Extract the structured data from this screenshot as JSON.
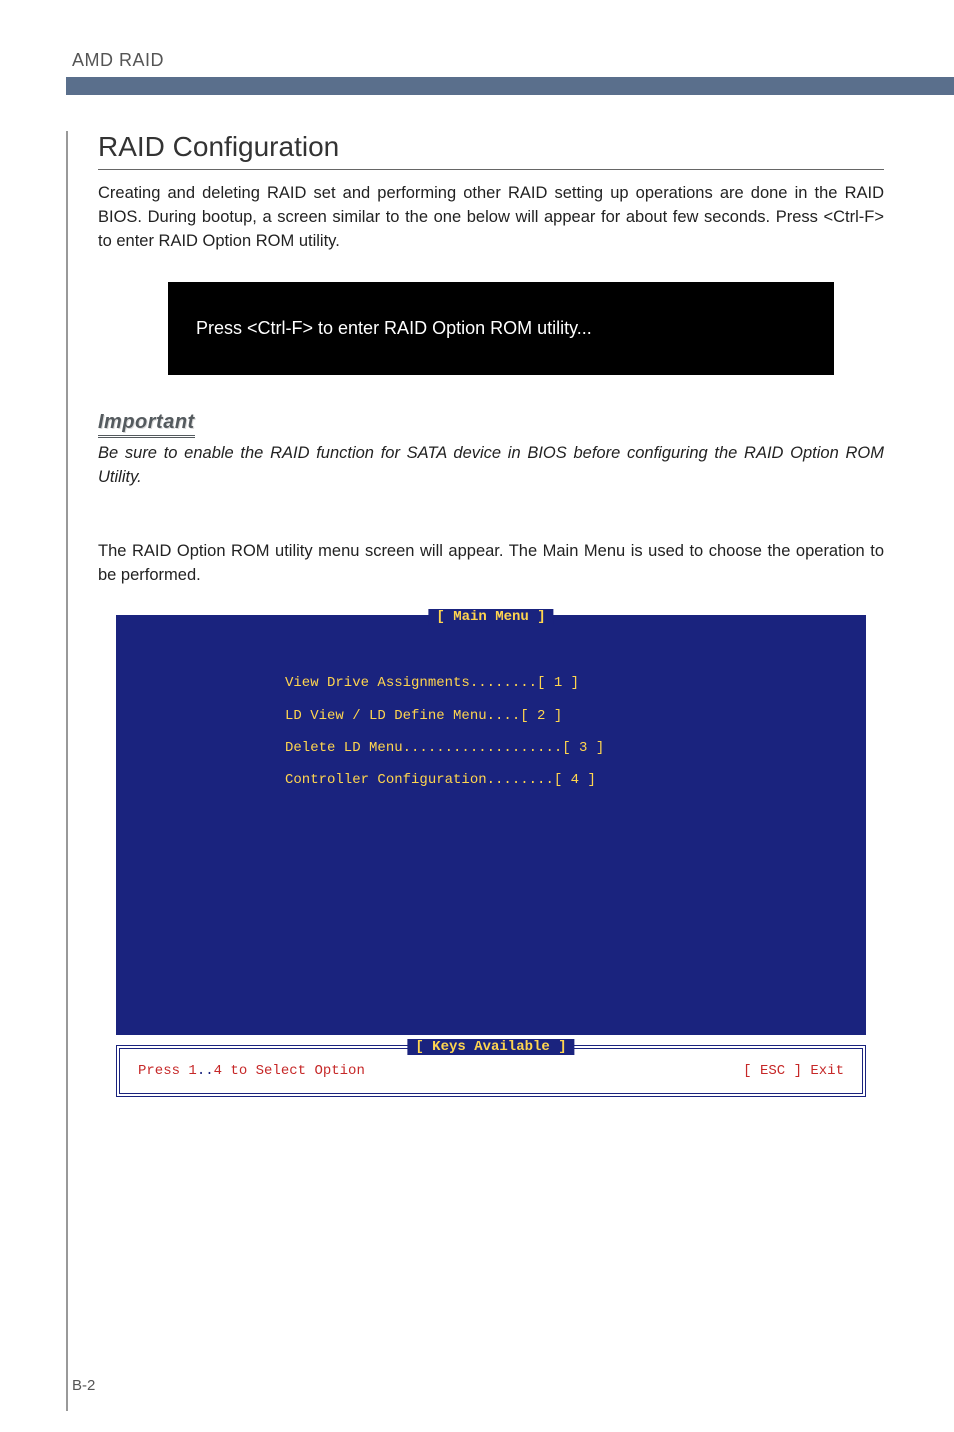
{
  "header": {
    "product": "AMD RAID"
  },
  "section": {
    "title": "RAID Configuration",
    "intro": "Creating and deleting RAID set and performing other RAID setting up operations are done in the RAID BIOS. During bootup, a screen similar to the one below will appear for about few seconds. Press <Ctrl-F> to enter RAID Option ROM utility."
  },
  "prompt_box": "Press <Ctrl-F> to enter RAID Option ROM utility...",
  "important": {
    "label": "Important",
    "body": "Be sure to enable the RAID function for SATA device in BIOS before configuring the RAID Option ROM Utility."
  },
  "para2": "The RAID Option ROM utility menu screen will appear. The Main Menu is used to choose the operation to be performed.",
  "bios": {
    "main_title": "[ Main Menu ]",
    "items": [
      "View Drive Assignments........[  1  ]",
      "LD View / LD Define Menu....[  2  ]",
      "Delete LD Menu...................[  3  ]",
      "Controller Configuration........[  4  ]"
    ],
    "keys_title": "[ Keys Available ]",
    "keys_left_prefix": "Press 1",
    "keys_left_dots": "..",
    "keys_left_suffix": "4 to Select Option",
    "keys_right": "[ ESC ]  Exit"
  },
  "page_number": "B-2"
}
